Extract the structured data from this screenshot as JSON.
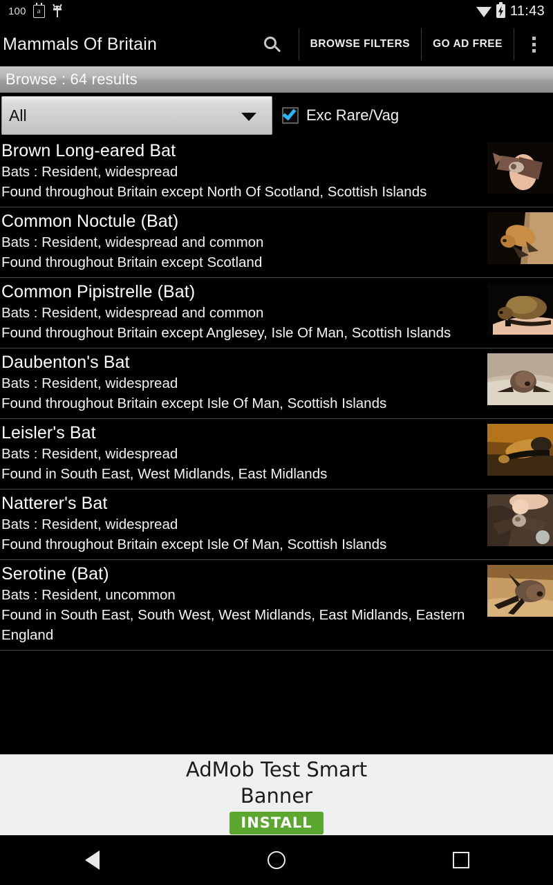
{
  "statusbar": {
    "left_number": "100",
    "icons_left": [
      "calendar-a-icon",
      "android-debug-icon"
    ],
    "icons_right": [
      "wifi-icon",
      "battery-charging-icon"
    ],
    "time": "11:43"
  },
  "actionbar": {
    "title": "Mammals Of Britain",
    "search_icon": "search-icon",
    "browse_filters_label": "BROWSE FILTERS",
    "go_ad_free_label": "GO AD FREE",
    "overflow_icon": "overflow-menu-icon"
  },
  "browsebar": {
    "label": "Browse : 64 results"
  },
  "filters": {
    "spinner_value": "All",
    "spinner_caret": "chevron-down-icon",
    "checkbox_label": "Exc Rare/Vag",
    "checkbox_checked": true,
    "checkbox_accent": "#29b6f6"
  },
  "list": {
    "items": [
      {
        "name": "Brown Long-eared Bat",
        "meta": "Bats : Resident, widespread",
        "found": "Found throughout Britain except North Of Scotland, Scottish Islands",
        "thumb": "bat-in-hand-photo"
      },
      {
        "name": "Common Noctule (Bat)",
        "meta": "Bats : Resident, widespread and common",
        "found": "Found throughout Britain except Scotland",
        "thumb": "bat-on-tree-bark-photo"
      },
      {
        "name": "Common Pipistrelle (Bat)",
        "meta": "Bats : Resident, widespread and common",
        "found": "Found throughout Britain except Anglesey, Isle Of Man, Scottish Islands",
        "thumb": "pipistrelle-on-hand-photo"
      },
      {
        "name": "Daubenton's Bat",
        "meta": "Bats : Resident, widespread",
        "found": "Found throughout Britain except Isle Of Man, Scottish Islands",
        "thumb": "bat-on-pale-ground-photo"
      },
      {
        "name": "Leisler's Bat",
        "meta": "Bats : Resident, widespread",
        "found": "Found in South East, West Midlands, East Midlands",
        "thumb": "leisler-bat-closeup-photo"
      },
      {
        "name": "Natterer's Bat",
        "meta": "Bats : Resident, widespread",
        "found": "Found throughout Britain except Isle Of Man, Scottish Islands",
        "thumb": "bat-held-by-hand-photo"
      },
      {
        "name": "Serotine (Bat)",
        "meta": "Bats : Resident, uncommon",
        "found": "Found in South East, South West, West Midlands, East Midlands, Eastern England",
        "thumb": "serotine-on-sand-photo"
      }
    ]
  },
  "ad": {
    "line1": "AdMob Test Smart",
    "line2": "Banner",
    "install_label": "INSTALL",
    "install_color": "#5ba72f"
  },
  "navbar": {
    "back": "back-icon",
    "home": "home-icon",
    "recents": "recents-icon"
  }
}
